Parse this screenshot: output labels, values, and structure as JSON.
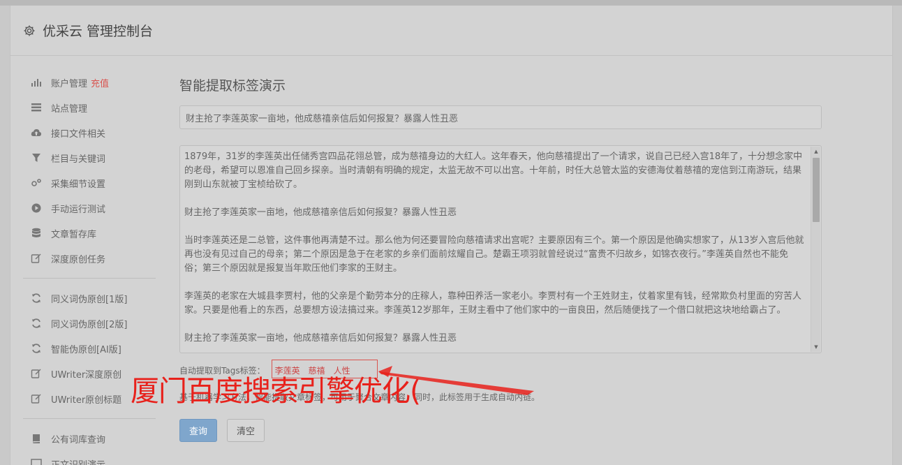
{
  "app": {
    "title": "优采云 管理控制台"
  },
  "sidebar": {
    "group1": [
      {
        "label": "账户管理",
        "extra": "充值",
        "icon": "bar-chart-icon"
      },
      {
        "label": "站点管理",
        "icon": "list-icon"
      },
      {
        "label": "接口文件相关",
        "icon": "cloud-upload-icon"
      },
      {
        "label": "栏目与关键词",
        "icon": "filter-icon"
      },
      {
        "label": "采集细节设置",
        "icon": "cogs-icon"
      },
      {
        "label": "手动运行测试",
        "icon": "play-circle-icon"
      },
      {
        "label": "文章暂存库",
        "icon": "database-icon"
      },
      {
        "label": "深度原创任务",
        "icon": "edit-icon"
      }
    ],
    "group2": [
      {
        "label": "同义词伪原创[1版]",
        "icon": "refresh-icon"
      },
      {
        "label": "同义词伪原创[2版]",
        "icon": "refresh-icon"
      },
      {
        "label": "智能伪原创[AI版]",
        "icon": "refresh-icon"
      },
      {
        "label": "UWriter深度原创",
        "icon": "edit-icon"
      },
      {
        "label": "UWriter原创标题",
        "icon": "edit-icon"
      }
    ],
    "group3": [
      {
        "label": "公有词库查询",
        "icon": "book-icon"
      },
      {
        "label": "正文识别演示",
        "icon": "monitor-icon"
      }
    ]
  },
  "main": {
    "page_title": "智能提取标签演示",
    "title_input_value": "财主抢了李莲英家一亩地，他成慈禧亲信后如何报复？暴露人性丑恶",
    "article_paragraphs": [
      "1879年，31岁的李莲英出任储秀宫四品花翎总管，成为慈禧身边的大红人。这年春天，他向慈禧提出了一个请求，说自己已经入宫18年了，十分想念家中的老母，希望可以恩准自己回乡探亲。当时清朝有明确的规定，太监无故不可以出宫。十年前，时任大总管太监的安德海仗着慈禧的宠信到江南游玩，结果刚到山东就被丁宝桢给砍了。",
      "财主抢了李莲英家一亩地，他成慈禧亲信后如何报复？暴露人性丑恶",
      "当时李莲英还是二总管，这件事他再清楚不过。那么他为何还要冒险向慈禧请求出宫呢？主要原因有三个。第一个原因是他确实想家了，从13岁入宫后他就再也没有见过自己的母亲；第二个原因是急于在老家的乡亲们面前炫耀自己。楚霸王项羽就曾经说过“富贵不归故乡，如锦衣夜行。”李莲英自然也不能免俗；第三个原因就是报复当年欺压他们李家的王财主。",
      "李莲英的老家在大城县李贾村，他的父亲是个勤劳本分的庄稼人，靠种田养活一家老小。李贾村有一个王姓财主，仗着家里有钱，经常欺负村里面的穷苦人家。只要是他看上的东西，总要想方设法搞过来。李莲英12岁那年，王财主看中了他们家中的一亩良田，然后随便找了一个借口就把这块地给霸占了。",
      "财主抢了李莲英家一亩地，他成慈禧亲信后如何报复？暴露人性丑恶"
    ],
    "tags_label": "自动提取到Tags标签：",
    "tags": [
      "李莲英",
      "慈禧",
      "人性"
    ],
    "hint": "基于机器学习方法，智能提取文章标签，可用于聚合文章内容，同时，此标签用于生成自动内链。",
    "query_button": "查询",
    "clear_button": "清空"
  },
  "overlay": {
    "text": "厦门百度搜索引擎优化("
  },
  "colors": {
    "accent": "#7fa6cc",
    "tag": "#cc4444",
    "overlay": "#e8211b"
  }
}
